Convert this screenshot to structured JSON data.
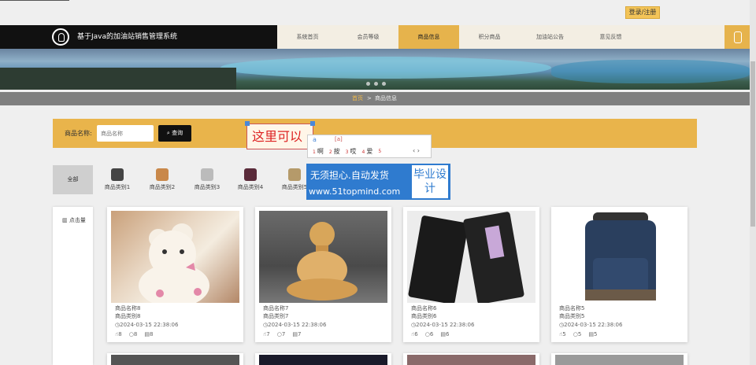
{
  "header": {
    "login_label": "登录/注册",
    "site_title": "基于Java的加油站销售管理系统",
    "nav": [
      "系统首页",
      "会员等级",
      "商品信息",
      "积分商品",
      "加油站公告",
      "意见反馈"
    ],
    "active_index": 2
  },
  "breadcrumb": {
    "home": "首页",
    "sep": ">",
    "current": "商品信息"
  },
  "search": {
    "label": "商品名称:",
    "placeholder": "商品名称",
    "button": "查询"
  },
  "ime": {
    "hint": "这里可以",
    "input": "a",
    "pinyin": "[a]",
    "candidates": [
      {
        "n": "1",
        "w": "啊"
      },
      {
        "n": "2",
        "w": "按"
      },
      {
        "n": "3",
        "w": "哎"
      },
      {
        "n": "4",
        "w": "爱"
      },
      {
        "n": "5",
        "w": ""
      }
    ],
    "nav": "‹ ›"
  },
  "categories": {
    "all": "全部",
    "items": [
      {
        "label": "商品类别1",
        "color": "#444"
      },
      {
        "label": "商品类别2",
        "color": "#c9884a"
      },
      {
        "label": "商品类别3",
        "color": "#bbb"
      },
      {
        "label": "商品类别4",
        "color": "#5a2b3a"
      },
      {
        "label": "商品类别5",
        "color": "#b59a6a"
      }
    ]
  },
  "watermark": {
    "line1": "无须担心.自动发货",
    "line2": "www.51topmind.com",
    "badge": "毕业设计"
  },
  "side": {
    "label": "点击量"
  },
  "products": [
    {
      "name": "商品名称8",
      "category": "商品类别8",
      "time": "2024-03-15 22:38:06",
      "likes": "8",
      "views": "8",
      "comments": "8"
    },
    {
      "name": "商品名称7",
      "category": "商品类别7",
      "time": "2024-03-15 22:38:06",
      "likes": "7",
      "views": "7",
      "comments": "7"
    },
    {
      "name": "商品名称6",
      "category": "商品类别6",
      "time": "2024-03-15 22:38:06",
      "likes": "6",
      "views": "6",
      "comments": "6"
    },
    {
      "name": "商品名称5",
      "category": "商品类别5",
      "time": "2024-03-15 22:38:06",
      "likes": "5",
      "views": "5",
      "comments": "5"
    }
  ],
  "icons": {
    "clock": "🕓",
    "like": "👍",
    "view": "👁",
    "comment": "💬",
    "search": "🔍",
    "chart": "📊"
  }
}
